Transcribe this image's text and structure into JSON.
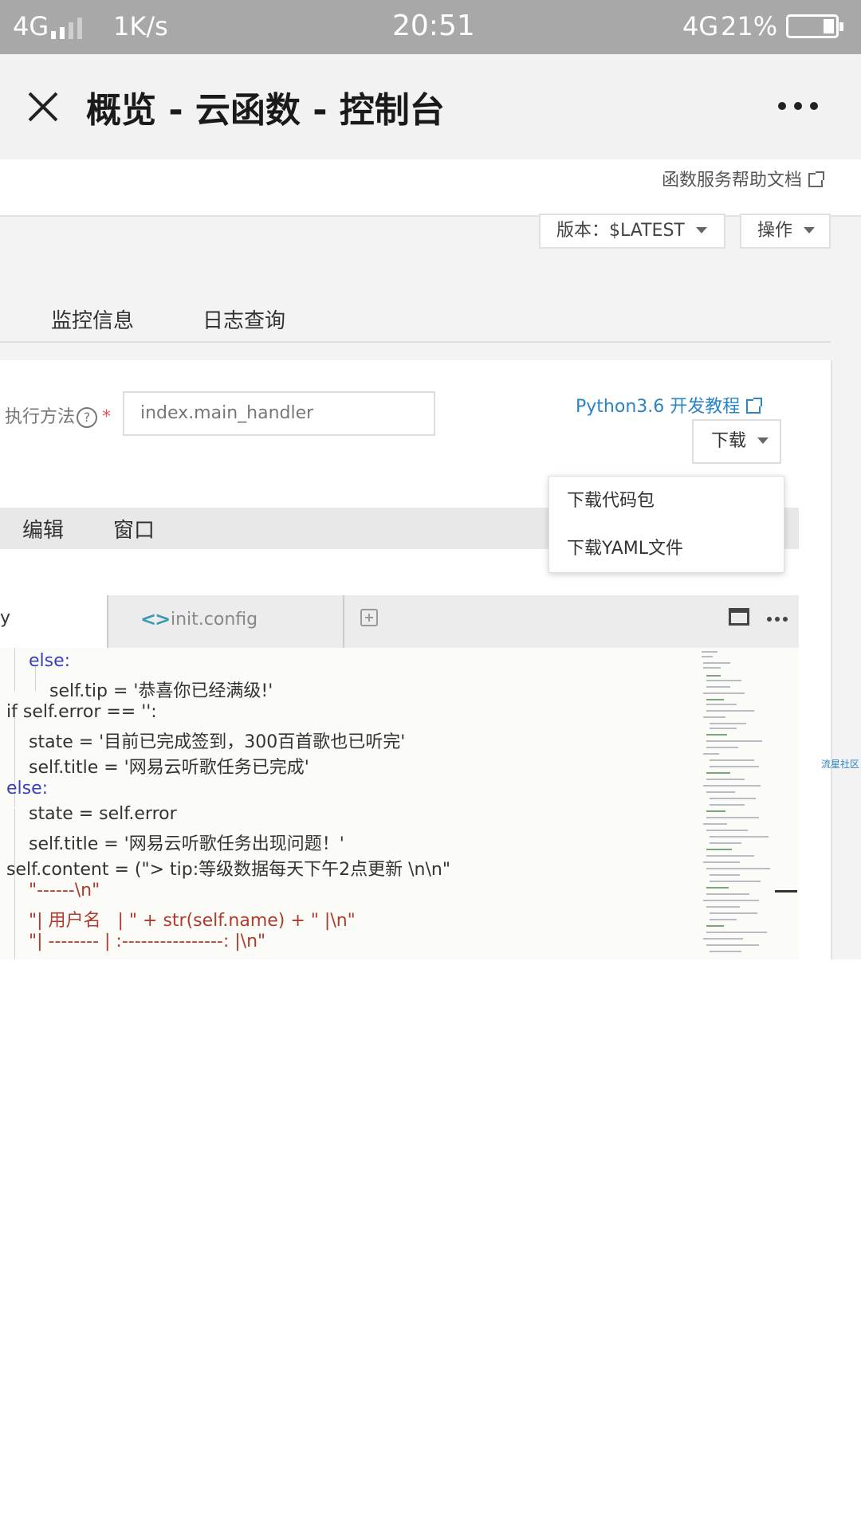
{
  "status_bar": {
    "network": "4G",
    "speed": "1K/s",
    "time": "20:51",
    "network_right": "4G",
    "battery": "21%"
  },
  "header": {
    "title": "概览 - 云函数 - 控制台"
  },
  "help_link": "函数服务帮助文档",
  "version_select": "版本：$LATEST",
  "action_select": "操作",
  "tabs": [
    "监控信息",
    "日志查询"
  ],
  "exec": {
    "label": "执行方法",
    "help": "?",
    "required": "*",
    "value": "index.main_handler"
  },
  "tutorial_link": "Python3.6 开发教程",
  "download_button": "下载",
  "download_menu": [
    "下载代码包",
    "下载YAML文件"
  ],
  "menu_bar": [
    "编辑",
    "窗口"
  ],
  "editor": {
    "active_tab": "y",
    "other_tab": "init.config"
  },
  "code_lines": [
    "else:",
    "self.tip = '恭喜你已经满级!'",
    "if self.error == '':",
    "state = '目前已完成签到，300百首歌也已听完'",
    "self.title = '网易云听歌任务已完成'",
    "else:",
    "state = self.error",
    "self.title = '网易云听歌任务出现问题！'",
    "self.content = (\"> tip:等级数据每天下午2点更新 \\n\\n\"",
    "\"------\\n\"",
    "\"| 用户名   | \" + str(self.name) + \" |\\n\"",
    "\"| -------- | :----------------: |\\n\""
  ],
  "side_link": "流星社区"
}
